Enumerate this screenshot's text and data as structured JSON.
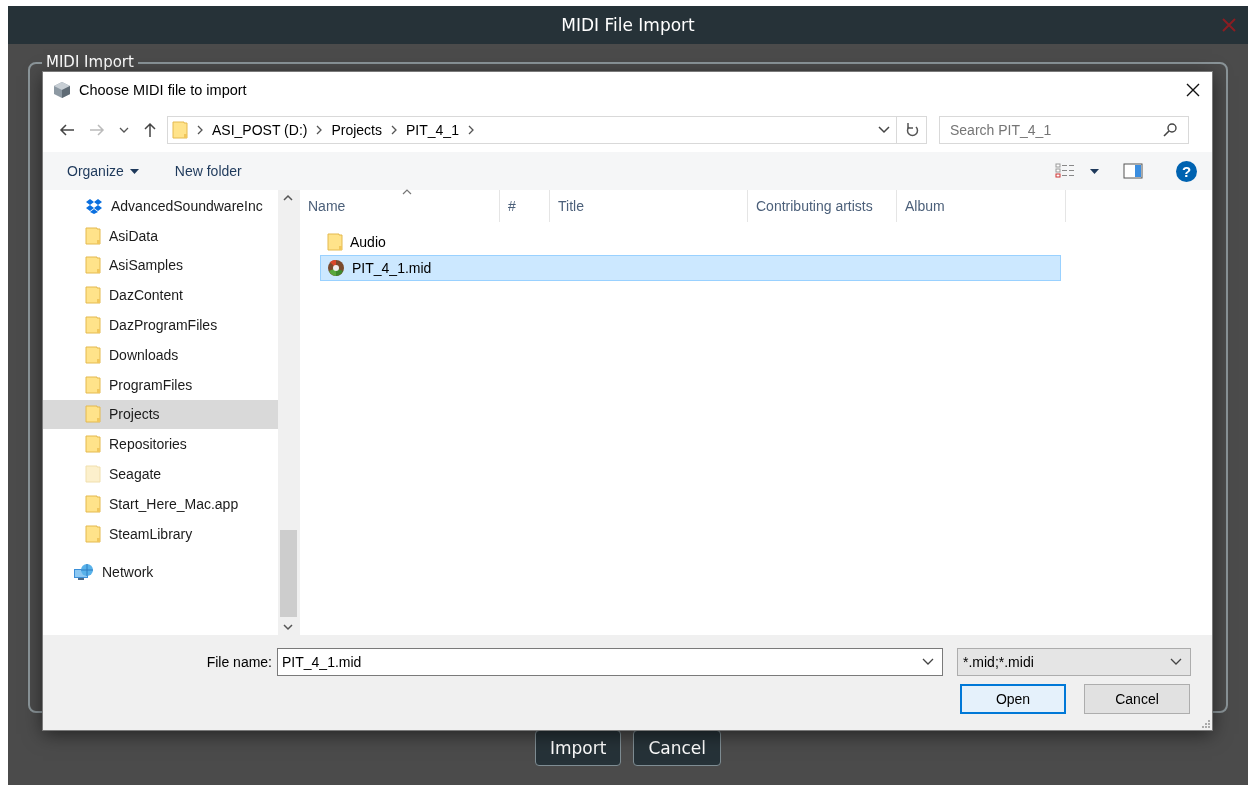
{
  "app_window": {
    "title": "MIDI File Import",
    "group_title": "MIDI Import",
    "buttons": [
      "Import",
      "Cancel"
    ]
  },
  "file_dialog": {
    "title": "Choose MIDI file to import",
    "breadcrumb": [
      "ASI_POST (D:)",
      "Projects",
      "PIT_4_1"
    ],
    "search": {
      "placeholder": "Search PIT_4_1"
    },
    "toolbar": {
      "organize": "Organize",
      "new_folder": "New folder",
      "help": "?"
    },
    "nav_items": [
      {
        "label": "AdvancedSoundwareInc",
        "kind": "cloud",
        "selected": false
      },
      {
        "label": "AsiData",
        "kind": "folder",
        "selected": false
      },
      {
        "label": "AsiSamples",
        "kind": "folder",
        "selected": false
      },
      {
        "label": "DazContent",
        "kind": "folder",
        "selected": false
      },
      {
        "label": "DazProgramFiles",
        "kind": "folder",
        "selected": false
      },
      {
        "label": "Downloads",
        "kind": "folder",
        "selected": false
      },
      {
        "label": "ProgramFiles",
        "kind": "folder",
        "selected": false
      },
      {
        "label": "Projects",
        "kind": "folder",
        "selected": true
      },
      {
        "label": "Repositories",
        "kind": "folder",
        "selected": false
      },
      {
        "label": "Seagate",
        "kind": "faded-folder",
        "selected": false
      },
      {
        "label": "Start_Here_Mac.app",
        "kind": "folder",
        "selected": false
      },
      {
        "label": "SteamLibrary",
        "kind": "folder",
        "selected": false
      },
      {
        "label": "Network",
        "kind": "network",
        "selected": false
      }
    ],
    "columns": [
      "Name",
      "#",
      "Title",
      "Contributing artists",
      "Album"
    ],
    "files": [
      {
        "name": "Audio",
        "kind": "folder",
        "selected": false
      },
      {
        "name": "PIT_4_1.mid",
        "kind": "midi",
        "selected": true
      }
    ],
    "file_name": {
      "label": "File name:",
      "value": "PIT_4_1.mid"
    },
    "file_type": "*.mid;*.midi",
    "buttons": [
      {
        "label": "Open",
        "default": true
      },
      {
        "label": "Cancel",
        "default": false
      }
    ]
  }
}
